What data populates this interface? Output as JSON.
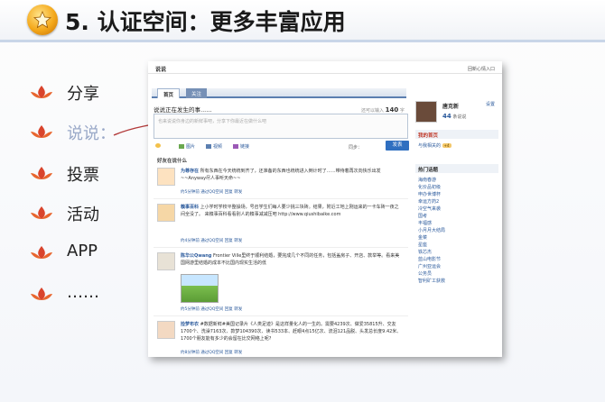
{
  "slide": {
    "title": "5. 认证空间：更多丰富应用",
    "bullets": [
      {
        "label": "分享"
      },
      {
        "label": "说说："
      },
      {
        "label": "投票"
      },
      {
        "label": "活动"
      },
      {
        "label": "APP"
      },
      {
        "label": "……"
      }
    ]
  },
  "screenshot": {
    "header_title": "说说",
    "header_link": "回新心情入口",
    "tabs": [
      {
        "label": "首页"
      },
      {
        "label": "关注"
      }
    ],
    "prompt": "说说正在发生的事......",
    "count_prefix": "还可以输入",
    "count_value": "140",
    "count_suffix": "字",
    "input_placeholder": "也来说说你身边的新鲜事吧，分享下你最近在做什么吧",
    "tools": [
      {
        "label": "图片"
      },
      {
        "label": "视频"
      },
      {
        "label": "链接"
      }
    ],
    "sync_label": "同步：",
    "send_label": "发表",
    "topic_label": "好友在说什么",
    "feed": [
      {
        "name": "为尊存在",
        "text": "所有东西在今天统统到齐了，还准备的东西也统统进入倒计时了……带待着再次向快乐出发~~Anyway尽人事听天命~~",
        "meta": "约5分钟前  通过QQ空间  回复  转发"
      },
      {
        "name": "糗事百科",
        "text": "上小学时学校平整操场，号召学生们每人要少挑三块砖。结果，附近工地上刚运来的一卡车砖一夜之间全没了。 来糗事百科看看别人的糗事减减压吧 http://www.qiushibaike.com",
        "meta": "约4分钟前  通过QQ空间  回复  转发"
      },
      {
        "name": "陈华公Qwang",
        "text": "Frontier Ville里终于顺利结婚，要完成几个不同的任务，包括盖房子、开店、款举等。看来美国网游里结婚的成本不比国内现实生活的低",
        "meta": "约5分钟前  通过QQ空间  回复  转发"
      },
      {
        "name": "捡梦布衣",
        "text": "#数据新鲜#美国记录片《人类足迹》是这样量化人的一生的。需要4239次、做爱35815升、交友1700个、洗澡7163次、款梦104390次、读书533本、赶眼4点15亿次、流泪121品脱、头发总长度9.42米、1700个朋友能有多少的会留在比交网络上呢?",
        "meta": "约8分钟前  通过QQ空间  回复  转发"
      }
    ],
    "profile": {
      "name": "唐克新",
      "count": "44",
      "count_label": "条说说",
      "settings": "设置"
    },
    "side_my_home": "我的首页",
    "side_related": "与我相关的",
    "side_badge": "+4",
    "side_hot_title": "热门话题",
    "hot_topics": [
      "海南春游",
      "化价品初级",
      "申办世博杯",
      "幸运方药2",
      "冷空气来袭",
      "国考",
      "丰福感",
      "小月月大结局",
      "金菜",
      "星座",
      "铁芯杰",
      "蓝山电影节",
      "广州亚运会",
      "公务员",
      "智利矿工获救"
    ]
  },
  "colors": {
    "accent": "#2f6fc0",
    "link": "#2b5a9c",
    "title_rule": "#c9d6e8",
    "bullet_icon": "#d9442c",
    "arrow": "#b23a3a"
  },
  "icons": {
    "logo": "star-emblem-icon",
    "bullet": "lotus-bullet-icon"
  }
}
